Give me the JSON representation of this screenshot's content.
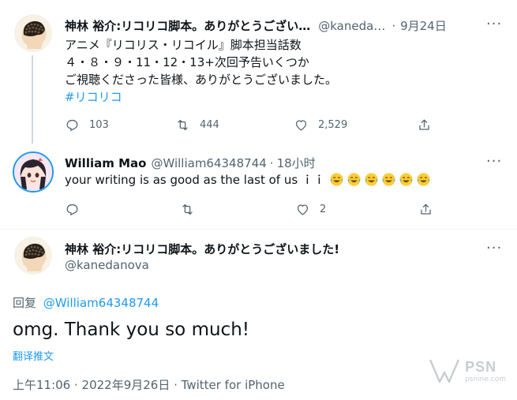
{
  "tweet1": {
    "name": "神林 裕介:リコリコ脚本。ありがとうござい…",
    "handle": "@kaneda…",
    "dot": "·",
    "date": "9月24日",
    "more": "···",
    "lines": [
      "アニメ『リコリス・リコイル』脚本担当話数",
      "４・８・９・11・12・13+次回予告いくつか",
      "ご視聴くださった皆様、ありがとうございました。"
    ],
    "hashtag": "#リコリコ",
    "reply_count": "103",
    "retweet_count": "444",
    "like_count": "2,529"
  },
  "tweet2": {
    "name": "William Mao",
    "handle": "@William64348744",
    "dot": "·",
    "time": "18小时",
    "more": "···",
    "text": "your writing is as good as the last of us ｉｉ",
    "emoji": [
      "face-with-tears-of-joy",
      "face-with-tears-of-joy",
      "face-with-tears-of-joy",
      "face-with-tears-of-joy",
      "face-with-tears-of-joy",
      "face-with-tears-of-joy"
    ],
    "like_count": "2"
  },
  "tweet3": {
    "name": "神林 裕介:リコリコ脚本。ありがとうございました!",
    "handle": "@kanedanova",
    "more": "···",
    "reply_prefix": "回复",
    "reply_to": "@William64348744",
    "text": "omg. Thank you so much!",
    "translate": "翻译推文",
    "timestamp": "上午11:06 · 2022年9月26日 · Twitter for iPhone"
  },
  "watermark": {
    "brand": "PSN",
    "sub": "psnine.com"
  },
  "colors": {
    "link": "#1d9bf0",
    "muted": "#536471",
    "emoji": "#ffcc33"
  }
}
